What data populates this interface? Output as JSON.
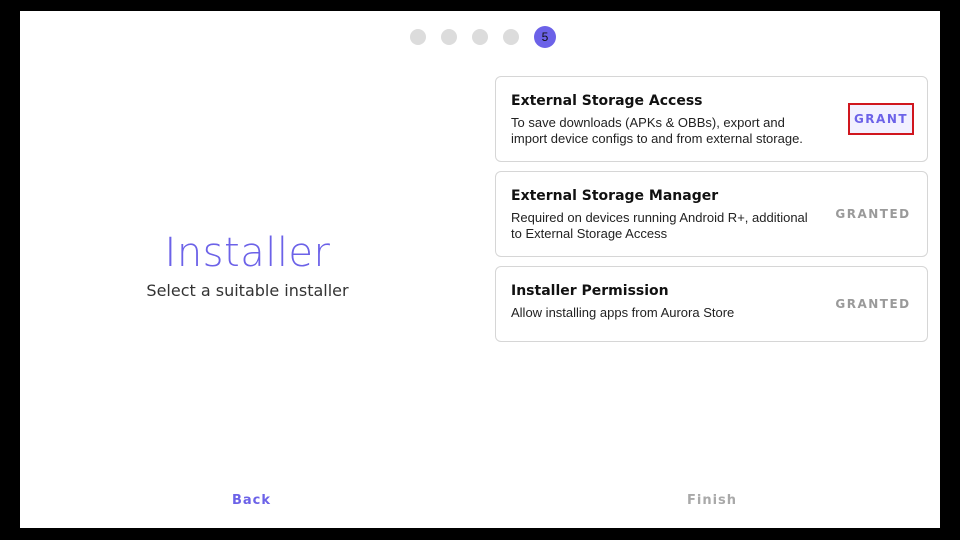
{
  "stepper": {
    "current_step": "5",
    "total_steps": 5
  },
  "intro": {
    "title": "Installer",
    "subtitle": "Select a suitable installer"
  },
  "permissions": [
    {
      "title": "External Storage Access",
      "description": "To save downloads (APKs & OBBs), export and import device configs to and from external storage.",
      "action": "GRANT"
    },
    {
      "title": "External Storage Manager",
      "description": "Required on devices running Android R+, additional to External Storage Access",
      "action": "GRANTED"
    },
    {
      "title": "Installer Permission",
      "description": "Allow installing apps from Aurora Store",
      "action": "GRANTED"
    }
  ],
  "footer": {
    "back_label": "Back",
    "finish_label": "Finish"
  },
  "colors": {
    "accent": "#6c62e8",
    "disabled": "#9a9a9a",
    "highlight_border": "#d0161e"
  }
}
